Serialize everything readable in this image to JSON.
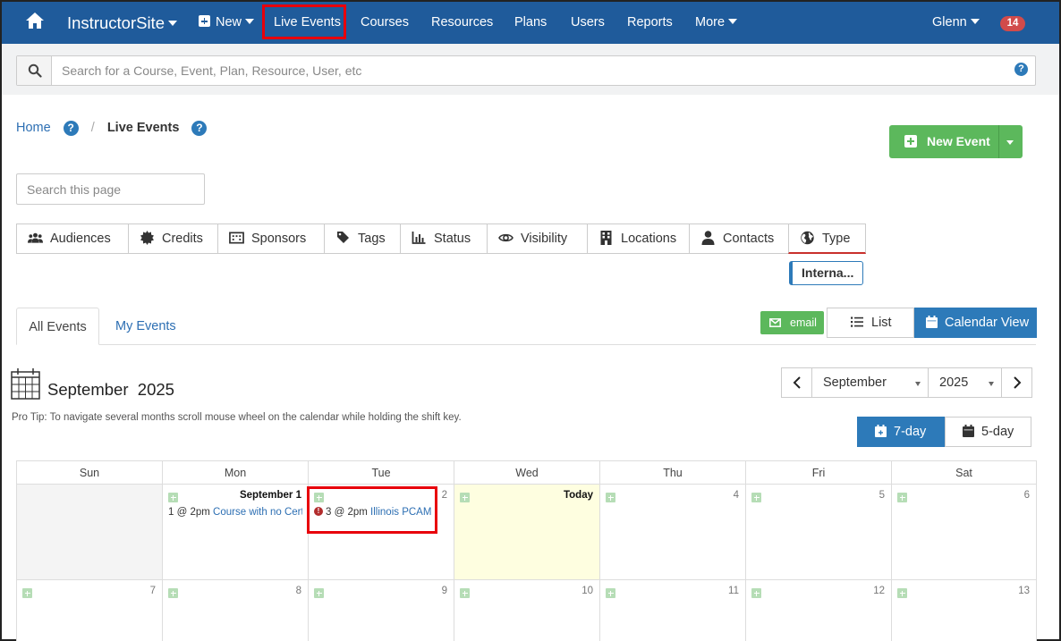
{
  "navbar": {
    "brand": "InstructorSite",
    "new_label": "New",
    "items": [
      "Live Events",
      "Courses",
      "Resources",
      "Plans",
      "Users",
      "Reports",
      "More"
    ],
    "user": "Glenn",
    "notification_count": "14",
    "icons": {
      "home": "home-icon",
      "new": "plus-square-icon",
      "caret": "caret-down-icon"
    }
  },
  "search": {
    "placeholder": "Search for a Course, Event, Plan, Resource, User, etc",
    "help": "?"
  },
  "breadcrumb": {
    "home": "Home",
    "current": "Live Events",
    "help": "?"
  },
  "new_event_label": "New Event",
  "page_search_placeholder": "Search this page",
  "filters": [
    "Audiences",
    "Credits",
    "Sponsors",
    "Tags",
    "Status",
    "Visibility",
    "Locations",
    "Contacts",
    "Type"
  ],
  "type_filter_tag": "Interna...",
  "tabs": {
    "all": "All Events",
    "mine": "My Events"
  },
  "email_label": "email",
  "views": {
    "list": "List",
    "calendar": "Calendar View"
  },
  "calendar": {
    "title_month": "September",
    "title_year": "2025",
    "pro_tip": "Pro Tip: To navigate several months scroll mouse wheel on the calendar while holding the shift key.",
    "selected_month": "September",
    "selected_year": "2025",
    "day_views": {
      "seven": "7-day",
      "five": "5-day"
    },
    "weekdays": [
      "Sun",
      "Mon",
      "Tue",
      "Wed",
      "Thu",
      "Fri",
      "Sat"
    ],
    "week1": [
      {
        "num": "",
        "out": true
      },
      {
        "num": "September 1",
        "bold": true,
        "event_prefix": "1 @ 2pm",
        "event_link": "Course with no Cert..."
      },
      {
        "num": "2",
        "event_prefix": "3 @ 2pm",
        "event_link": "Illinois PCAM",
        "error": true
      },
      {
        "num": "Today",
        "bold": true,
        "today": true
      },
      {
        "num": "4"
      },
      {
        "num": "5"
      },
      {
        "num": "6"
      }
    ],
    "week2": [
      "7",
      "8",
      "9",
      "10",
      "11",
      "12",
      "13"
    ]
  },
  "colors": {
    "navbar": "#1f5b9b",
    "accent_blue": "#2d7ab9",
    "success_green": "#5cb85c",
    "highlight_red": "#e8000b",
    "today_bg": "#fefee0"
  }
}
